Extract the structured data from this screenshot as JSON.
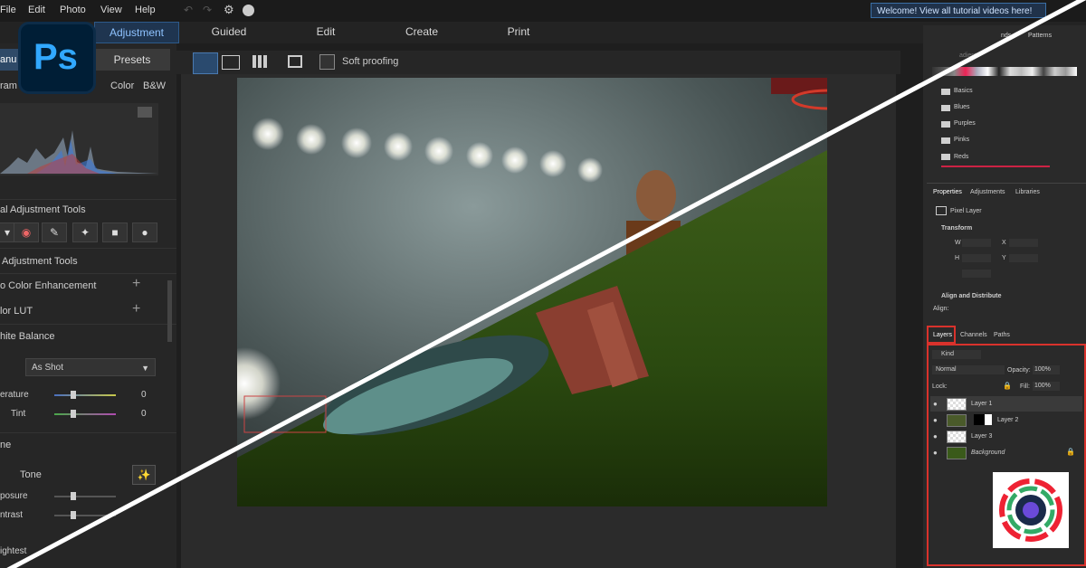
{
  "menu": {
    "items": [
      "File",
      "Edit",
      "Photo",
      "View",
      "Help"
    ],
    "welcome": "Welcome! View all tutorial videos here!"
  },
  "modes": {
    "adjustment": "Adjustment",
    "guided": "Guided",
    "edit": "Edit",
    "create": "Create",
    "print": "Print"
  },
  "left": {
    "tab_manual": "anu",
    "tab_presets": "Presets",
    "histogram_label": "ram",
    "color": "Color",
    "bw": "B&W",
    "local_tools": "al Adjustment Tools",
    "adj_tools": "Adjustment Tools",
    "auto_color": "o Color Enhancement",
    "color_lut": "lor LUT",
    "white_balance": "hite Balance",
    "as_shot": "As Shot",
    "temperature": "erature",
    "temperature_value": "0",
    "tint": "Tint",
    "tint_value": "0",
    "tone_section": "ne",
    "tone": "Tone",
    "exposure": "posure",
    "contrast": "ntrast",
    "brightest": "ightest"
  },
  "view": {
    "soft_proofing": "Soft proofing"
  },
  "right": {
    "tab_swatches": "nds",
    "tab_patterns": "Patterns",
    "gradients": "adients",
    "folders": [
      "Basics",
      "Blues",
      "Purples",
      "Pinks",
      "Reds"
    ],
    "props_tabs": [
      "Properties",
      "Adjustments",
      "Libraries"
    ],
    "pixel_layer": "Pixel Layer",
    "transform": "Transform",
    "w_label": "W",
    "h_label": "H",
    "x_label": "X",
    "y_label": "Y",
    "align": "Align and Distribute",
    "align_sub": "Align:",
    "layers_tabs": [
      "Layers",
      "Channels",
      "Paths"
    ],
    "kind": "Kind",
    "blend": "Normal",
    "opacity_label": "Opacity:",
    "opacity": "100%",
    "lock_label": "Lock:",
    "fill_label": "Fill:",
    "fill": "100%",
    "layers": [
      "Layer 1",
      "Layer 2",
      "Layer 3",
      "Background"
    ]
  },
  "colors": {
    "accent_blue": "#2d5a8a",
    "highlight_red": "#d9322c",
    "ps_blue": "#31a8ff",
    "ps_dark": "#001e36"
  },
  "icons": [
    "photoshop-logo",
    "photodirector-logo",
    "gear-icon",
    "undo-icon",
    "redo-icon",
    "eye-icon",
    "folder-icon",
    "plus-icon",
    "lock-icon"
  ]
}
